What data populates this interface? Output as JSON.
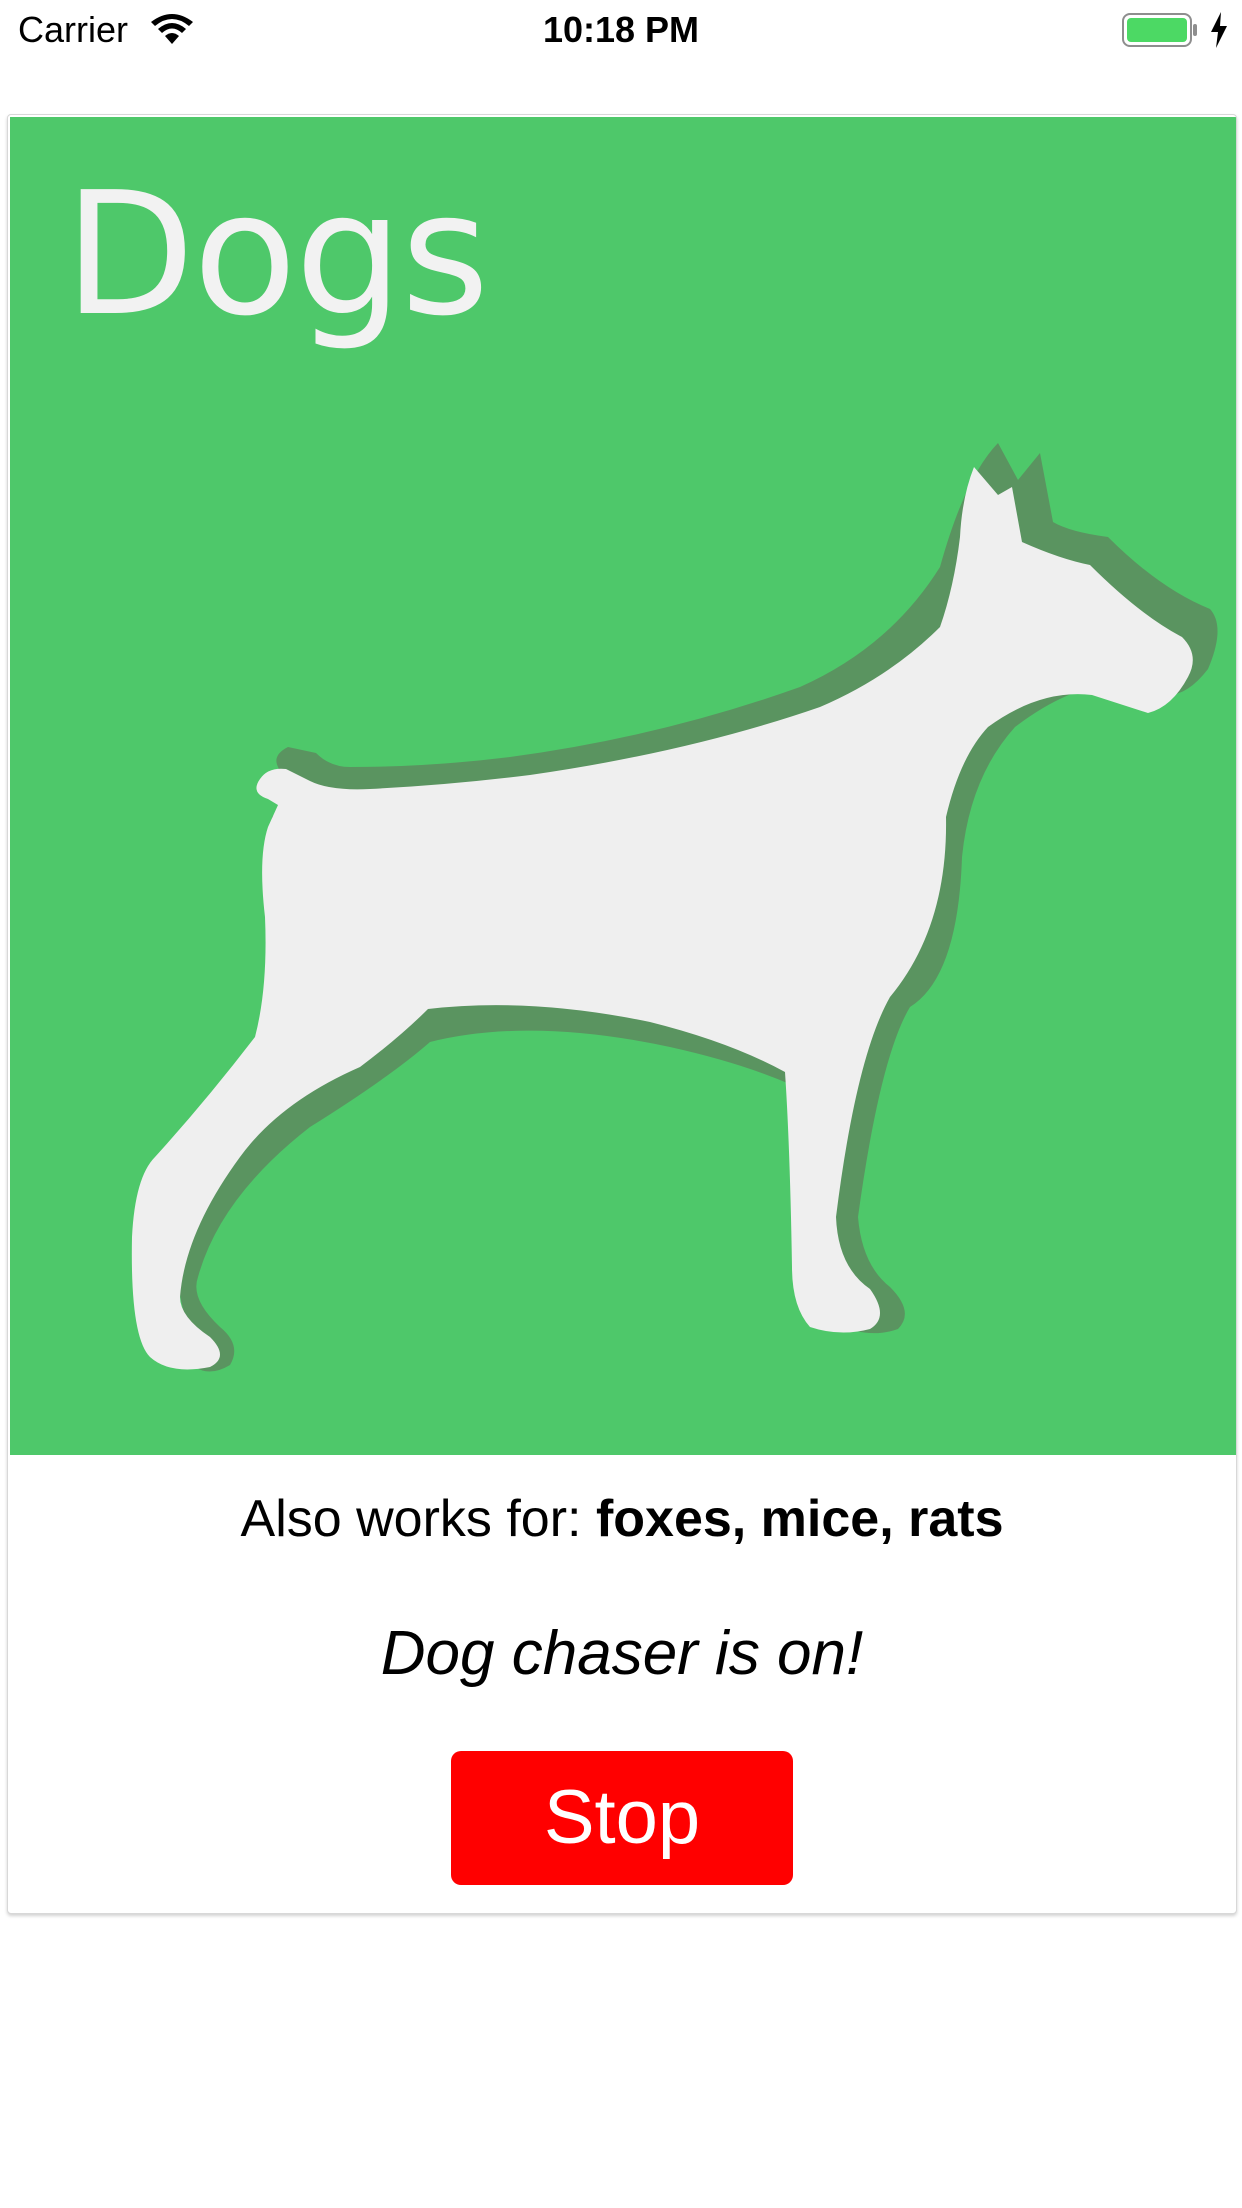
{
  "status_bar": {
    "carrier": "Carrier",
    "time": "10:18 PM",
    "battery_color": "#4cd964",
    "icons": [
      "wifi-icon",
      "battery-icon",
      "charging-icon"
    ]
  },
  "card": {
    "image": {
      "title": "Dogs",
      "background_color": "#4ec86a",
      "silhouette_color": "#efefef",
      "shadow_color": "#5a9460",
      "icon": "dog-silhouette"
    },
    "also_works_prefix": "Also works for: ",
    "also_works_animals": "foxes, mice, rats",
    "status_message": "Dog chaser is on!",
    "stop_label": "Stop",
    "stop_color": "#ff0000"
  }
}
